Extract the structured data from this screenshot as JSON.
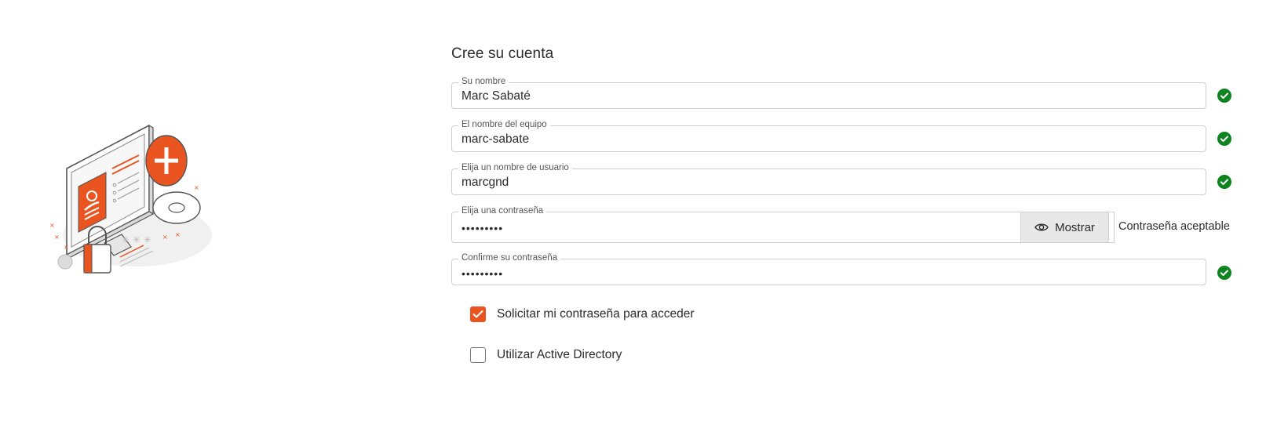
{
  "colors": {
    "accent": "#e95420",
    "success": "#0e8420",
    "border": "#cfcfcf"
  },
  "title": "Cree su cuenta",
  "fields": {
    "name": {
      "label": "Su nombre",
      "value": "Marc Sabaté",
      "status_icon": "check-circle-icon"
    },
    "hostname": {
      "label": "El nombre del equipo",
      "value": "marc-sabate",
      "status_icon": "check-circle-icon"
    },
    "username": {
      "label": "Elija un nombre de usuario",
      "value": "marcgnd",
      "status_icon": "check-circle-icon"
    },
    "password": {
      "label": "Elija una contraseña",
      "value": "•••••••••",
      "show_label": "Mostrar",
      "show_icon": "eye-icon",
      "strength": "Contraseña aceptable"
    },
    "confirm": {
      "label": "Confirme su contraseña",
      "value": "•••••••••",
      "status_icon": "check-circle-icon"
    }
  },
  "options": {
    "require_password": {
      "label": "Solicitar mi contraseña para acceder",
      "checked": true
    },
    "active_directory": {
      "label": "Utilizar Active Directory",
      "checked": false
    }
  }
}
